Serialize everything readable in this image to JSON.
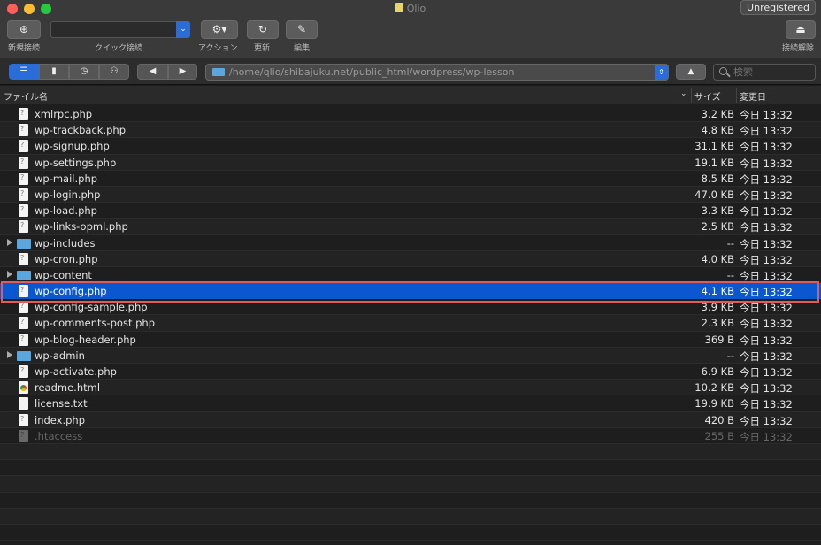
{
  "window": {
    "title": "Qlio",
    "unregistered_label": "Unregistered"
  },
  "toolbar": {
    "new_connection": "新規接続",
    "quick_connect": "クイック接続",
    "action": "アクション",
    "refresh": "更新",
    "edit": "編集",
    "disconnect": "接続解除"
  },
  "navbar": {
    "path": "/home/qlio/shibajuku.net/public_html/wordpress/wp-lesson",
    "search_placeholder": "検索"
  },
  "columns": {
    "name": "ファイル名",
    "size": "サイズ",
    "modified": "変更日"
  },
  "files": [
    {
      "name": "xmlrpc.php",
      "size": "3.2 KB",
      "date": "今日 13:32",
      "type": "file"
    },
    {
      "name": "wp-trackback.php",
      "size": "4.8 KB",
      "date": "今日 13:32",
      "type": "file"
    },
    {
      "name": "wp-signup.php",
      "size": "31.1 KB",
      "date": "今日 13:32",
      "type": "file"
    },
    {
      "name": "wp-settings.php",
      "size": "19.1 KB",
      "date": "今日 13:32",
      "type": "file"
    },
    {
      "name": "wp-mail.php",
      "size": "8.5 KB",
      "date": "今日 13:32",
      "type": "file"
    },
    {
      "name": "wp-login.php",
      "size": "47.0 KB",
      "date": "今日 13:32",
      "type": "file"
    },
    {
      "name": "wp-load.php",
      "size": "3.3 KB",
      "date": "今日 13:32",
      "type": "file"
    },
    {
      "name": "wp-links-opml.php",
      "size": "2.5 KB",
      "date": "今日 13:32",
      "type": "file"
    },
    {
      "name": "wp-includes",
      "size": "--",
      "date": "今日 13:32",
      "type": "folder"
    },
    {
      "name": "wp-cron.php",
      "size": "4.0 KB",
      "date": "今日 13:32",
      "type": "file"
    },
    {
      "name": "wp-content",
      "size": "--",
      "date": "今日 13:32",
      "type": "folder"
    },
    {
      "name": "wp-config.php",
      "size": "4.1 KB",
      "date": "今日 13:32",
      "type": "file",
      "selected": true
    },
    {
      "name": "wp-config-sample.php",
      "size": "3.9 KB",
      "date": "今日 13:32",
      "type": "file"
    },
    {
      "name": "wp-comments-post.php",
      "size": "2.3 KB",
      "date": "今日 13:32",
      "type": "file"
    },
    {
      "name": "wp-blog-header.php",
      "size": "369 B",
      "date": "今日 13:32",
      "type": "file"
    },
    {
      "name": "wp-admin",
      "size": "--",
      "date": "今日 13:32",
      "type": "folder"
    },
    {
      "name": "wp-activate.php",
      "size": "6.9 KB",
      "date": "今日 13:32",
      "type": "file"
    },
    {
      "name": "readme.html",
      "size": "10.2 KB",
      "date": "今日 13:32",
      "type": "html"
    },
    {
      "name": "license.txt",
      "size": "19.9 KB",
      "date": "今日 13:32",
      "type": "txt"
    },
    {
      "name": "index.php",
      "size": "420 B",
      "date": "今日 13:32",
      "type": "file"
    },
    {
      "name": ".htaccess",
      "size": "255 B",
      "date": "今日 13:32",
      "type": "file",
      "hidden": true
    }
  ]
}
